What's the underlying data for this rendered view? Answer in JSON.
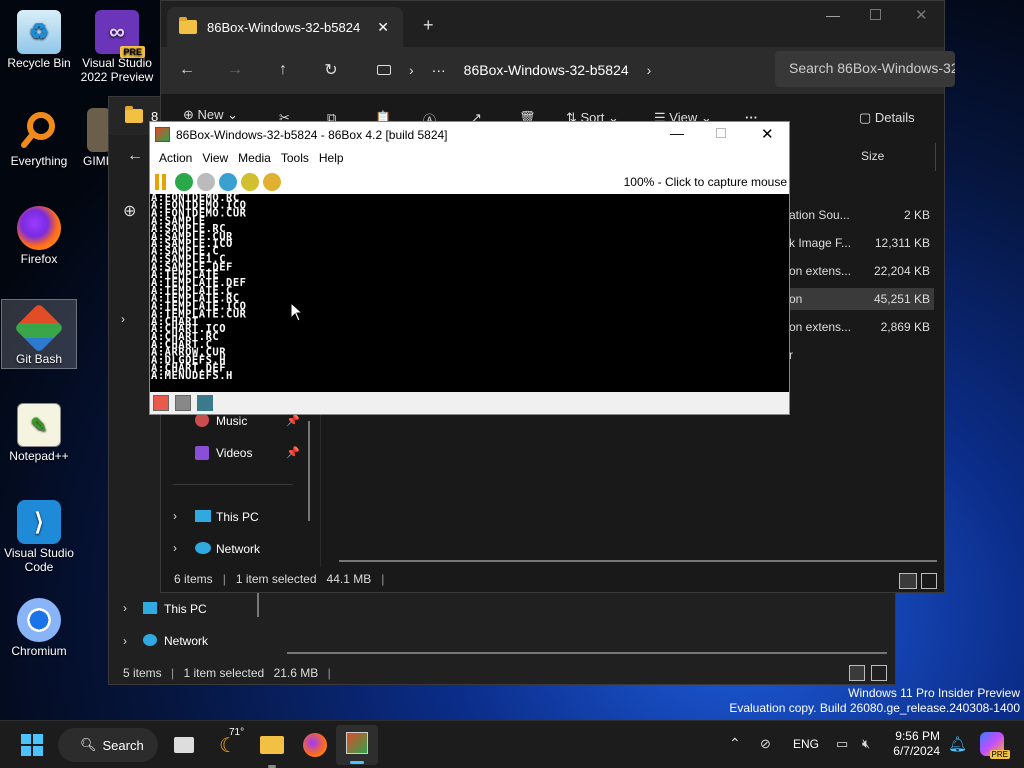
{
  "desktop": {
    "icons": [
      {
        "label": "Recycle Bin"
      },
      {
        "label": "Visual Studio 2022 Preview",
        "badge": "PRE"
      },
      {
        "label": "Everything"
      },
      {
        "label": "GIMP"
      },
      {
        "label": "Firefox"
      },
      {
        "label": "Git Bash"
      },
      {
        "label": "Notepad++"
      },
      {
        "label": "Visual Studio Code"
      },
      {
        "label": "Chromium"
      }
    ],
    "watermark": {
      "line1": "Windows 11 Pro Insider Preview",
      "line2": "Evaluation copy. Build 26080.ge_release.240308-1400"
    }
  },
  "explorer_front": {
    "tab_title": "86Box-Windows-32-b5824",
    "tab_close": "✕",
    "new_tab": "+",
    "breadcrumb_more": "···",
    "breadcrumb": "86Box-Windows-32-b5824",
    "search_placeholder": "Search 86Box-Windows-32-b5824",
    "cmd": {
      "new": "New",
      "sort": "Sort",
      "view": "View",
      "more": "···",
      "details": "Details"
    },
    "column_size": "Size",
    "files": [
      {
        "type": "ation Sou...",
        "size": "2 KB"
      },
      {
        "type": "k Image F...",
        "size": "12,311 KB"
      },
      {
        "type": "on extens...",
        "size": "22,204 KB"
      },
      {
        "type": "on",
        "size": "45,251 KB"
      },
      {
        "type": "on extens...",
        "size": "2,869 KB"
      },
      {
        "type": "r",
        "size": ""
      }
    ],
    "sidebar": [
      {
        "label": "Music"
      },
      {
        "label": "Videos"
      },
      {
        "label": "This PC"
      },
      {
        "label": "Network"
      }
    ],
    "status": {
      "items": "6 items",
      "selected": "1 item selected",
      "size": "44.1 MB"
    }
  },
  "explorer_back": {
    "tab_fragment": "8",
    "gimp_fragment": "GIMI",
    "sidebar": [
      {
        "label": "This PC"
      },
      {
        "label": "Network"
      }
    ],
    "status": {
      "items": "5 items",
      "selected": "1 item selected",
      "size": "21.6 MB"
    }
  },
  "emulator": {
    "title": "86Box-Windows-32-b5824 - 86Box 4.2 [build 5824]",
    "menu": [
      "Action",
      "View",
      "Media",
      "Tools",
      "Help"
    ],
    "capture_hint": "100% - Click to capture mouse",
    "screen_lines": [
      "A:FONTDEMO.RC",
      "A:FONTDEMO.ICO",
      "A:FONTDEMO.CUR",
      "A:SAMPLE",
      "A:SAMPLE.RC",
      "A:SAMPLE.CUR",
      "A:SAMPLE.ICO",
      "A:SAMPLE.C",
      "A:SAMPLE1.C",
      "A:SAMPLE.DEF",
      "A:TEMPLATE",
      "A:TEMPLATE.DEF",
      "A:TEMPLATE.C",
      "A:TEMPLATE.RC",
      "A:TEMPLATE.ICO",
      "A:TEMPLATE.CUR",
      "A:CHART",
      "A:CHART.ICO",
      "A:CHART.RC",
      "A:CHART.C",
      "A:ARROW.CUR",
      "A:DLGDEFS.H",
      "A:CHART.DEF",
      "A:MENUDEFS.H"
    ]
  },
  "taskbar": {
    "search_label": "Search",
    "weather": "71°",
    "lang": "ENG",
    "time": "9:56 PM",
    "date": "6/7/2024",
    "badge": "PRE"
  }
}
